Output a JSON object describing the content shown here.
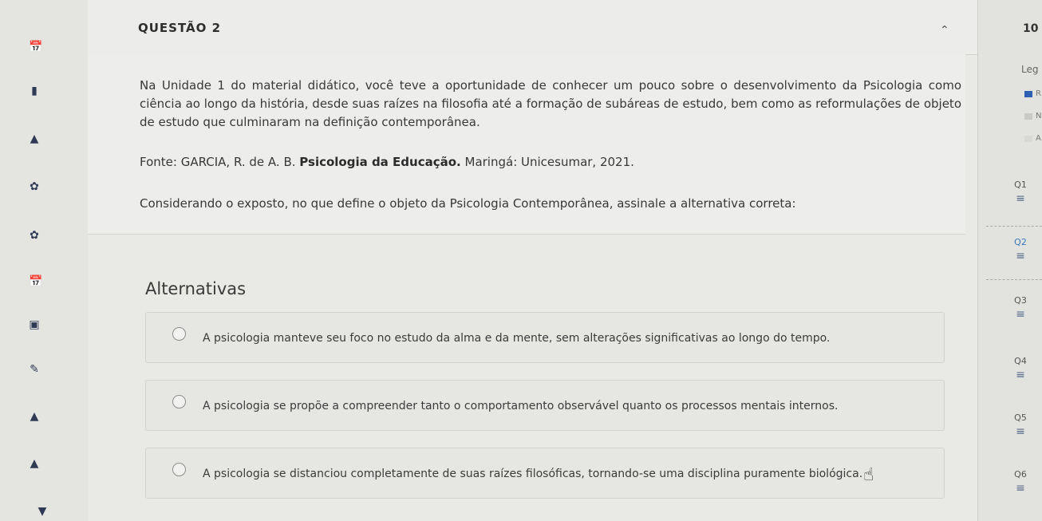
{
  "question": {
    "title": "QUESTÃO 2",
    "stem": "Na Unidade 1 do material didático, você teve a oportunidade de conhecer um pouco sobre o desenvolvimento da Psicologia como ciência ao longo da história, desde suas raízes na filosofia até a formação de subáreas de estudo, bem como as reformulações de objeto de estudo que culminaram na definição contemporânea.",
    "source_prefix": "Fonte: GARCIA, R. de A. B. ",
    "source_bold": "Psicologia da Educação.",
    "source_suffix": " Maringá: Unicesumar, 2021.",
    "prompt": "Considerando o exposto, no que define o objeto da Psicologia Contemporânea, assinale a alternativa correta:"
  },
  "alternatives": {
    "heading": "Alternativas",
    "options": [
      "A psicologia manteve seu foco no estudo da alma e da mente, sem alterações significativas ao longo do tempo.",
      "A psicologia se propõe a compreender tanto o comportamento observável quanto os processos mentais internos.",
      "A psicologia se distanciou completamente de suas raízes filosóficas, tornando-se uma disciplina puramente biológica."
    ]
  },
  "right_panel": {
    "score": "10",
    "legend_label": "Leg",
    "legend_items": [
      {
        "text": "R",
        "color": "#2f5fb0"
      },
      {
        "text": "N",
        "color": "#c9c9c6"
      },
      {
        "text": "A",
        "color": "#d8d8d4"
      }
    ],
    "questions": [
      "Q1",
      "Q2",
      "Q3",
      "Q4",
      "Q5",
      "Q6"
    ]
  },
  "icons": {
    "left_rail": [
      "calendar-icon",
      "book-icon",
      "graduation-cap-icon",
      "leaf-icon",
      "leaf-icon",
      "calendar-icon",
      "briefcase-icon",
      "pencil-icon",
      "graduation-cap-icon",
      "graduation-cap-icon",
      "basket-icon"
    ],
    "question_list": "list-icon",
    "collapse": "chevron-up-icon",
    "cursor": "hand-cursor-icon"
  }
}
